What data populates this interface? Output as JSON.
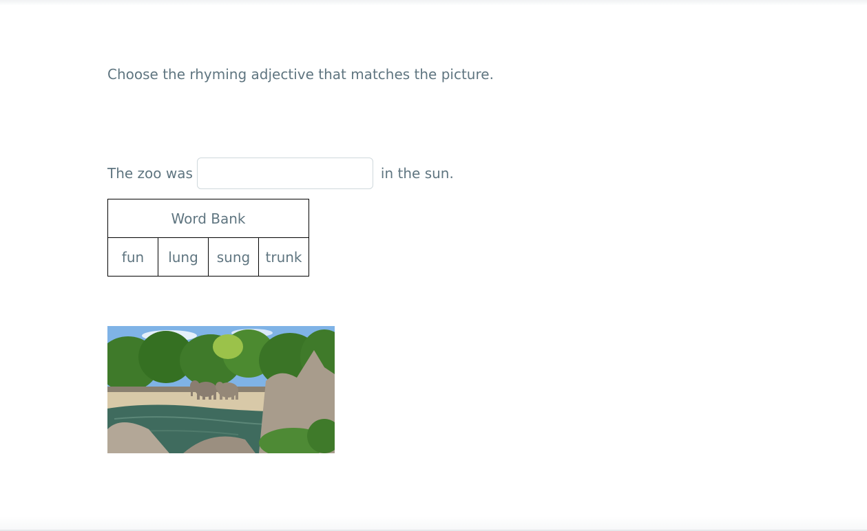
{
  "question": {
    "instruction": "Choose the rhyming adjective that matches the picture.",
    "sentence_before": "The zoo was",
    "sentence_after": "in the sun.",
    "answer_value": "",
    "answer_placeholder": ""
  },
  "word_bank": {
    "title": "Word Bank",
    "words": [
      "fun",
      "lung",
      "sung",
      "trunk"
    ]
  },
  "picture": {
    "subject": "elephants-at-zoo-pond",
    "colors": {
      "sky": "#7fb3e6",
      "trees": "#3f7a2a",
      "ground": "#d8c9a8",
      "water": "#3f6b5e",
      "rocks": "#a89c8c"
    }
  }
}
